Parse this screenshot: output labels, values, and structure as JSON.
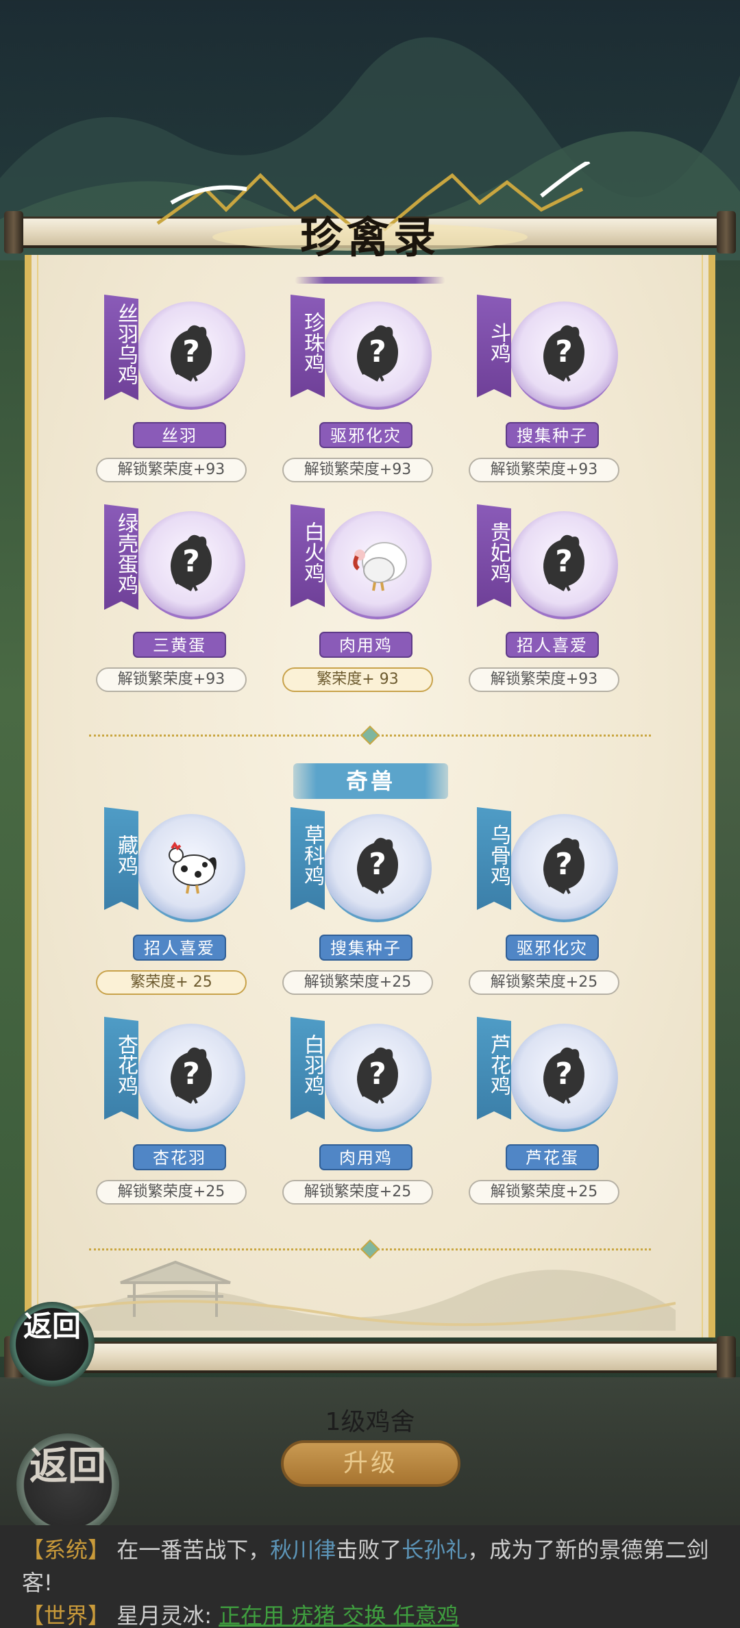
{
  "title": "珍禽录",
  "rare_birds": [
    {
      "name": "丝羽乌鸡",
      "tag": "丝羽",
      "unlock": "解锁繁荣度+93",
      "unlocked": false
    },
    {
      "name": "珍珠鸡",
      "tag": "驱邪化灾",
      "unlock": "解锁繁荣度+93",
      "unlocked": false
    },
    {
      "name": "斗鸡",
      "tag": "搜集种子",
      "unlock": "解锁繁荣度+93",
      "unlocked": false
    },
    {
      "name": "绿壳蛋鸡",
      "tag": "三黄蛋",
      "unlock": "解锁繁荣度+93",
      "unlocked": false
    },
    {
      "name": "白火鸡",
      "tag": "肉用鸡",
      "unlock": "繁荣度+ 93",
      "unlocked": true
    },
    {
      "name": "贵妃鸡",
      "tag": "招人喜爱",
      "unlock": "解锁繁荣度+93",
      "unlocked": false
    }
  ],
  "section2_title": "奇兽",
  "odd_beasts": [
    {
      "name": "藏鸡",
      "tag": "招人喜爱",
      "unlock": "繁荣度+ 25",
      "unlocked": true
    },
    {
      "name": "草科鸡",
      "tag": "搜集种子",
      "unlock": "解锁繁荣度+25",
      "unlocked": false
    },
    {
      "name": "乌骨鸡",
      "tag": "驱邪化灾",
      "unlock": "解锁繁荣度+25",
      "unlocked": false
    },
    {
      "name": "杏花鸡",
      "tag": "杏花羽",
      "unlock": "解锁繁荣度+25",
      "unlocked": false
    },
    {
      "name": "白羽鸡",
      "tag": "肉用鸡",
      "unlock": "解锁繁荣度+25",
      "unlocked": false
    },
    {
      "name": "芦花鸡",
      "tag": "芦花蛋",
      "unlock": "解锁繁荣度+25",
      "unlocked": false
    }
  ],
  "return_label": "返回",
  "coop_level": "1级鸡舍",
  "upgrade_label": "升级",
  "chat": {
    "system_channel": "【系统】",
    "system_pre": "在一番苦战下，",
    "winner": "秋川律",
    "system_mid": "击败了",
    "loser": "长孙礼",
    "system_post": "，成为了新的景德第二剑客!",
    "world_channel": "【世界】",
    "world_user": "星月灵冰:",
    "world_msg": "正在用 疣猪 交换 任意鸡"
  },
  "colors": {
    "purple": "#8a5bb8",
    "blue": "#5086c6",
    "gold": "#d9b85a"
  },
  "icons": {
    "locked": "question-chicken-silhouette-icon",
    "turkey": "white-turkey-icon",
    "tibetan": "tibetan-chicken-icon"
  }
}
